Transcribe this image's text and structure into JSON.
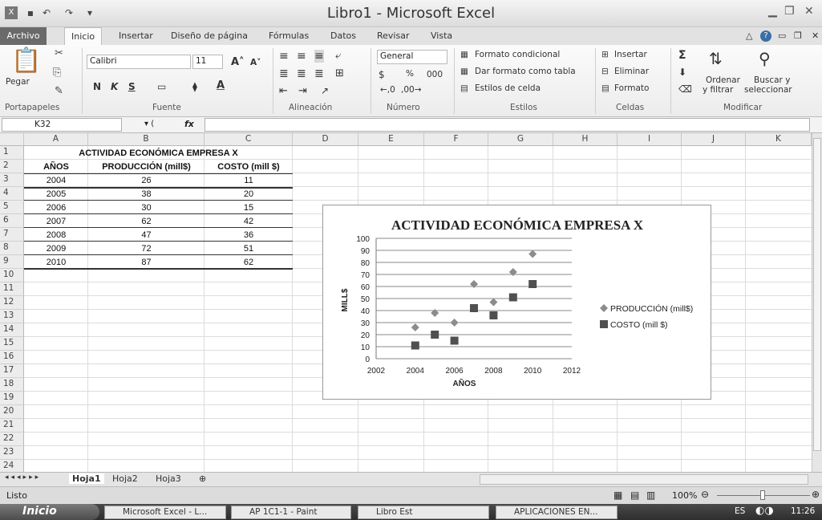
{
  "window": {
    "title": "Libro1 - Microsoft Excel"
  },
  "tabs": [
    {
      "label": "Archivo"
    },
    {
      "label": "Inicio"
    },
    {
      "label": "Insertar"
    },
    {
      "label": "Diseño de página"
    },
    {
      "label": "Fórmulas"
    },
    {
      "label": "Datos"
    },
    {
      "label": "Revisar"
    },
    {
      "label": "Vista"
    }
  ],
  "ribbon": {
    "clipboard": {
      "paste": "Pegar",
      "group": "Portapapeles"
    },
    "font": {
      "name": "Calibri",
      "size": "11",
      "group": "Fuente"
    },
    "alignment": {
      "group": "Alineación"
    },
    "number": {
      "format": "General",
      "group": "Número"
    },
    "styles": {
      "cond": "Formato condicional",
      "table": "Dar formato como tabla",
      "cell": "Estilos de celda",
      "group": "Estilos"
    },
    "cells": {
      "insert": "Insertar",
      "delete": "Eliminar",
      "format": "Formato",
      "group": "Celdas"
    },
    "editing": {
      "sort1": "Ordenar",
      "sort2": "y filtrar",
      "find1": "Buscar y",
      "find2": "seleccionar",
      "group": "Modificar"
    }
  },
  "formula_bar": {
    "name_box": "K32",
    "fx": "fx",
    "formula": ""
  },
  "columns": [
    "A",
    "B",
    "C",
    "D",
    "E",
    "F",
    "G",
    "H",
    "I",
    "J",
    "K"
  ],
  "rows": [
    "1",
    "2",
    "3",
    "4",
    "5",
    "6",
    "7",
    "8",
    "9",
    "10",
    "11",
    "12",
    "13",
    "14",
    "15",
    "16",
    "17",
    "18",
    "19",
    "20",
    "21",
    "22",
    "23",
    "24"
  ],
  "table": {
    "title": "ACTIVIDAD ECONÓMICA  EMPRESA X",
    "headers": [
      "AÑOS",
      "PRODUCCIÓN (mill$)",
      "COSTO (mill $)"
    ],
    "rows": [
      [
        "2004",
        "26",
        "11"
      ],
      [
        "2005",
        "38",
        "20"
      ],
      [
        "2006",
        "30",
        "15"
      ],
      [
        "2007",
        "62",
        "42"
      ],
      [
        "2008",
        "47",
        "36"
      ],
      [
        "2009",
        "72",
        "51"
      ],
      [
        "2010",
        "87",
        "62"
      ]
    ]
  },
  "chart_data": {
    "type": "scatter",
    "title": "ACTIVIDAD ECONÓMICA  EMPRESA X",
    "xlabel": "AÑOS",
    "ylabel": "MILL$",
    "xlim": [
      2002,
      2012
    ],
    "ylim": [
      0,
      100
    ],
    "xticks": [
      2002,
      2004,
      2006,
      2008,
      2010,
      2012
    ],
    "yticks": [
      0,
      10,
      20,
      30,
      40,
      50,
      60,
      70,
      80,
      90,
      100
    ],
    "grid": true,
    "legend": "right",
    "series": [
      {
        "name": "PRODUCCIÓN (mill$)",
        "marker": "diamond",
        "color": "#8c8c8c",
        "x": [
          2004,
          2005,
          2006,
          2007,
          2008,
          2009,
          2010
        ],
        "y": [
          26,
          38,
          30,
          62,
          47,
          72,
          87
        ]
      },
      {
        "name": "COSTO (mill $)",
        "marker": "square",
        "color": "#505050",
        "x": [
          2004,
          2005,
          2006,
          2007,
          2008,
          2009,
          2010
        ],
        "y": [
          11,
          20,
          15,
          42,
          36,
          51,
          62
        ]
      }
    ]
  },
  "sheets": [
    {
      "label": "Hoja1"
    },
    {
      "label": "Hoja2"
    },
    {
      "label": "Hoja3"
    }
  ],
  "status": {
    "mode": "Listo",
    "zoom": "100%"
  },
  "taskbar": {
    "start": "Inicio",
    "items": [
      "Microsoft Excel - L...",
      "AP 1C1-1 - Paint",
      "Libro Est",
      "APLICACIONES EN..."
    ],
    "lang": "ES",
    "time": "11:26"
  }
}
